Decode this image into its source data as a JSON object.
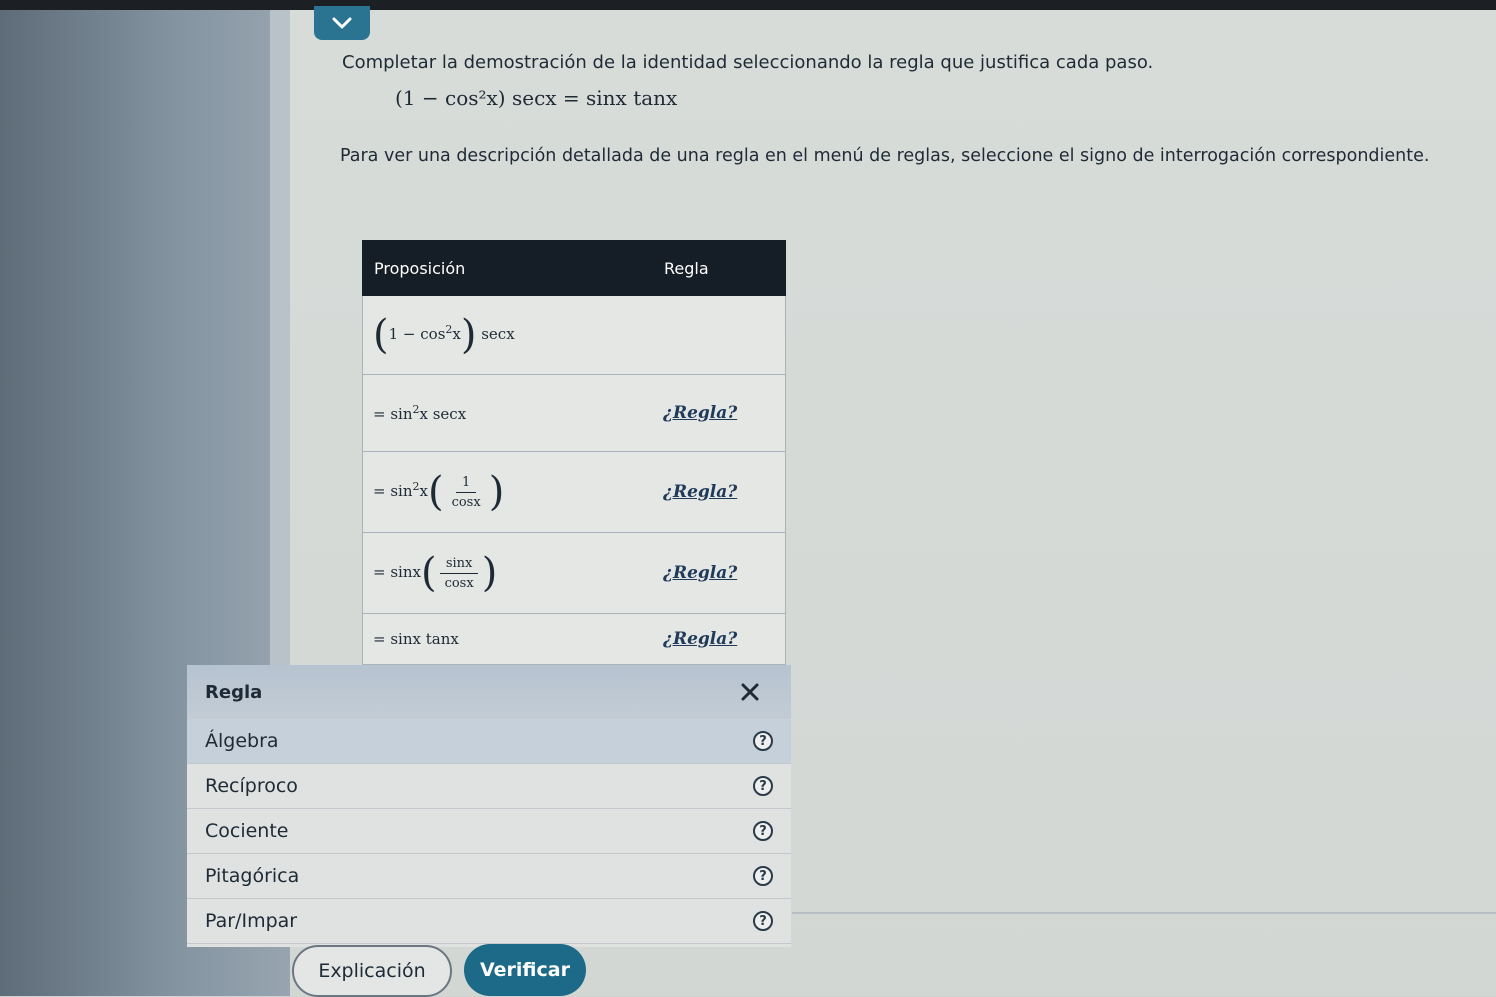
{
  "instruction": "Completar la demostración de la identidad seleccionando la regla que justifica cada paso.",
  "identity": "(1 − cos²x) secx = sinx tanx",
  "hint": "Para ver una descripción detallada de una regla en el menú de reglas, seleccione el signo de interrogación correspondiente.",
  "table": {
    "header_prop": "Proposición",
    "header_rule": "Regla",
    "rows": [
      {
        "rule": ""
      },
      {
        "rule": "¿Regla?"
      },
      {
        "rule": "¿Regla?"
      },
      {
        "rule": "¿Regla?"
      },
      {
        "rule": "¿Regla?"
      }
    ]
  },
  "rule_menu": {
    "title": "Regla",
    "items": [
      {
        "label": "Álgebra"
      },
      {
        "label": "Recíproco"
      },
      {
        "label": "Cociente"
      },
      {
        "label": "Pitagórica"
      },
      {
        "label": "Par/Impar"
      }
    ],
    "help": "?"
  },
  "buttons": {
    "explain": "Explicación",
    "verify": "Verificar"
  },
  "colors": {
    "accent": "#1c6a87",
    "table_header": "#151d26"
  },
  "icons": [
    "chevron-down-icon",
    "close-icon",
    "help-icon"
  ]
}
